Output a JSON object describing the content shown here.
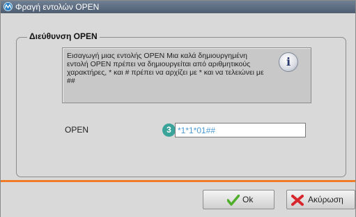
{
  "window": {
    "title": "Φραγή εντολών OPEN",
    "icon": "app-logo-icon"
  },
  "group": {
    "title": "Διεύθυνση OPEN"
  },
  "info": {
    "text": "Εισαγωγή μιας εντολής OPEN Μια καλά δημιουργημένη εντολή OPEN πρέπει να δημιουργείται από αριθμητικούς χαρακτήρες, * και # πρέπει να αρχίζει με * και να τελειώνει με ##",
    "icon": "info-icon",
    "icon_glyph": "i"
  },
  "form": {
    "open_label": "OPEN",
    "open_value": "*1*1*01##",
    "step_number": "3"
  },
  "buttons": {
    "ok_label": "Ok",
    "cancel_label": "Ακύρωση"
  },
  "colors": {
    "accent": "#f07c2a",
    "step_badge": "#3aa39a",
    "input_text": "#4a9bd4"
  }
}
